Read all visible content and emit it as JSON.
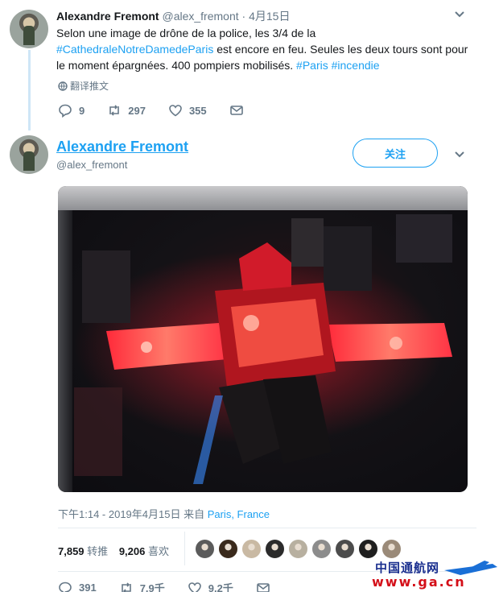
{
  "tweet1": {
    "name": "Alexandre Fremont",
    "handle": "@alex_fremont",
    "date": "4月15日",
    "text_1": "Selon une image de drône de la police, les 3/4 de la",
    "hashtag_cathedral": "#CathedraleNotreDamedeParis",
    "text_2": " est encore en feu. Seules les deux tours sont pour le moment épargnées. 400 pompiers mobilisés. ",
    "hashtag_paris": "#Paris",
    "hashtag_incendie": "#incendie",
    "translate_label": "翻译推文",
    "replies": "9",
    "retweets": "297",
    "likes": "355"
  },
  "tweet2": {
    "name": "Alexandre Fremont",
    "handle": "@alex_fremont",
    "follow_label": "关注",
    "timestamp": "下午1:14 - 2019年4月15日 来自 ",
    "location": "Paris, France",
    "retweet_count": "7,859",
    "retweet_label": "转推",
    "like_count": "9,206",
    "like_label": "喜欢",
    "replies": "391",
    "retweets": "7.9千",
    "likes": "9.2千"
  },
  "photo": {
    "description_icon": "burning-cathedral-aerial-photo"
  },
  "liker_colors": [
    "#5b5b5b",
    "#3a2a1c",
    "#c9b9a3",
    "#2b2b2b",
    "#b8b0a0",
    "#8c8c8c",
    "#4c4c4c",
    "#1f1f1f",
    "#9a8a78"
  ],
  "watermark": {
    "name": "中国通航网",
    "url": "www.ga.cn"
  },
  "colors": {
    "accent": "#1da1f2",
    "text": "#14171a",
    "muted": "#657786"
  }
}
